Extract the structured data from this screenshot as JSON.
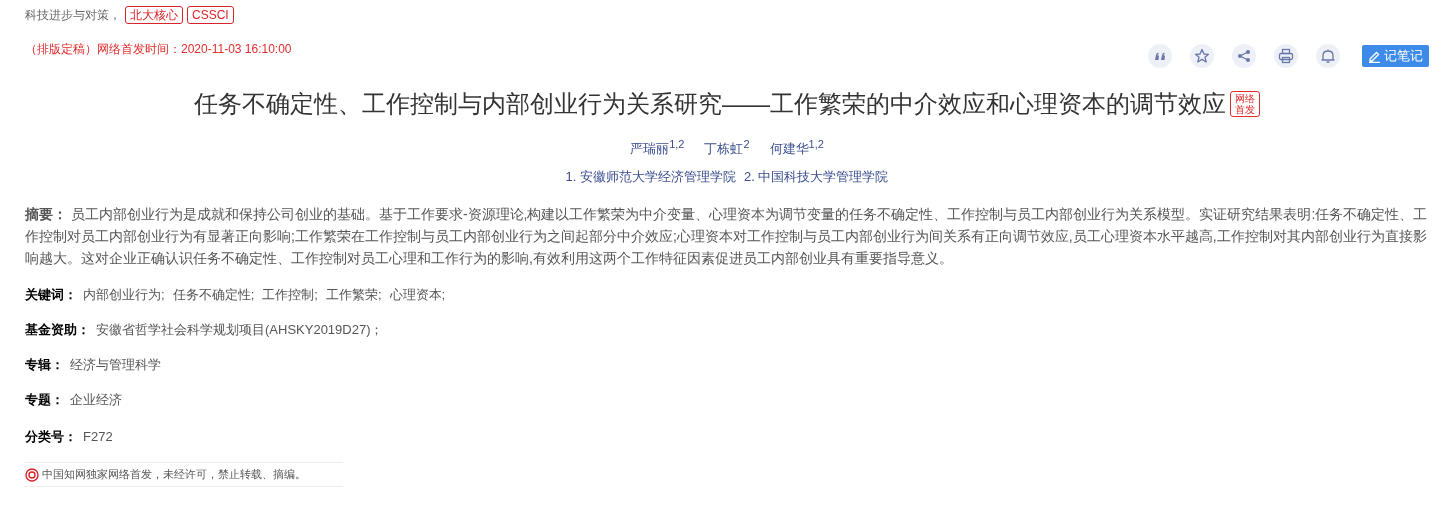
{
  "source": {
    "journal": "科技进步与对策，",
    "badges": [
      "北大核心",
      "CSSCI"
    ]
  },
  "publish_note": "（排版定稿）网络首发时间：2020-11-03 16:10:00",
  "toolbar": {
    "icons": [
      {
        "kind": "quote"
      },
      {
        "kind": "star"
      },
      {
        "kind": "share"
      },
      {
        "kind": "print"
      },
      {
        "kind": "bell"
      }
    ],
    "note_button": "记笔记"
  },
  "title": "任务不确定性、工作控制与内部创业行为关系研究——工作繁荣的中介效应和心理资本的调节效应",
  "title_badge": "网络首发",
  "authors": [
    "严瑞丽$^{1,2}$",
    "丁栋虹$^{2}$",
    "何建华$^{1,2}$"
  ],
  "affiliations": [
    "1. 安徽师范大学经济管理学院",
    "2. 中国科技大学管理学院"
  ],
  "fields": [
    {
      "kind": "paragraph",
      "text": "**摘要：** 员工内部创业行为是成就和保持公司创业的基础。基于工作要求-资源理论,构建以工作繁荣为中介变量、心理资本为调节变量的任务不确定性、工作控制与员工内部创业行为关系模型。实证研究结果表明:任务不确定性、工作控制对员工内部创业行为有显著正向影响;工作繁荣在工作控制与员工内部创业行为之间起部分中介效应;心理资本对工作控制与员工内部创业行为间关系有正向调节效应,员工心理资本水平越高,工作控制对其内部创业行为直接影响越大。这对企业正确认识任务不确定性、工作控制对员工心理和工作行为的影响,有效利用这两个工作特征因素促进员工内部创业具有重要指导意义。"
    },
    {
      "kind": "links",
      "label": "关键词：",
      "items": [
        "内部创业行为;",
        "任务不确定性;",
        "工作控制;",
        "工作繁荣;",
        "心理资本;"
      ]
    },
    {
      "kind": "links",
      "label": "基金资助：",
      "items": [
        "安徽省哲学社会科学规划项目(AHSKY2019D27)；"
      ]
    },
    {
      "kind": "links",
      "label": "专辑：",
      "items": [
        "经济与管理科学"
      ]
    },
    {
      "kind": "links",
      "label": "专题：",
      "items": [
        "企业经济"
      ]
    },
    {
      "kind": "text",
      "label": "分类号：",
      "value": "F272"
    }
  ],
  "notice": "中国知网独家网络首发，未经许可，禁止转载、摘编。"
}
